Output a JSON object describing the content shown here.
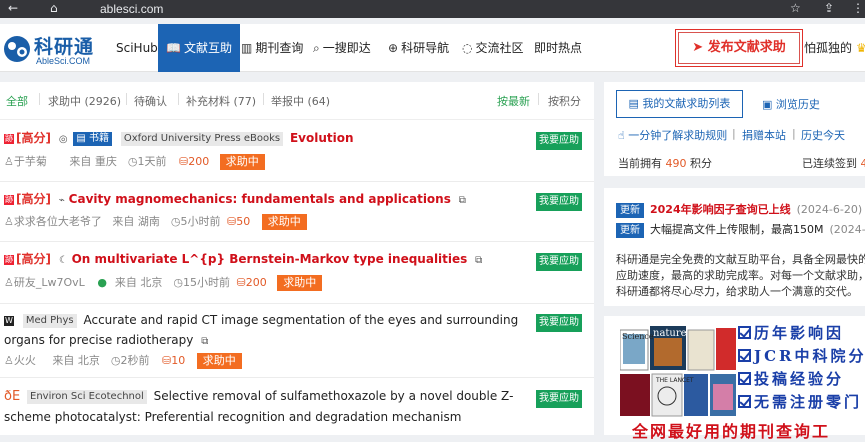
{
  "browser": {
    "url": "ablesci.com",
    "back_glyph": "←",
    "home_glyph": "⌂",
    "star_glyph": "☆",
    "ext_glyph": "⇪",
    "more_glyph": "⋮"
  },
  "header": {
    "logo_cn": "科研通",
    "logo_en": "AbleSci.COM",
    "nav": [
      {
        "label": "SciHub",
        "icon": ""
      },
      {
        "label": "文献互助",
        "icon": "open-book-icon"
      },
      {
        "label": "期刊查询",
        "icon": "journal-icon"
      },
      {
        "label": "一搜即达",
        "icon": "search-icon"
      },
      {
        "label": "科研导航",
        "icon": "globe-icon"
      },
      {
        "label": "交流社区",
        "icon": "chat-icon"
      },
      {
        "label": "即时热点",
        "icon": ""
      }
    ],
    "publish_label": "发布文献求助",
    "username": "怕孤独的"
  },
  "filters": {
    "all": "全部",
    "seeking": "求助中 (2926)",
    "pending": "待确认",
    "supplement": "补充材料 (77)",
    "reporting": "举报中 (64)",
    "sort_new": "按最新",
    "sort_points": "按积分"
  },
  "requests": [
    {
      "high_score": "[高分]",
      "journal": "Oxford University Press eBooks",
      "book_label": "书籍",
      "title": "Evolution",
      "user": "于芋菊",
      "origin": "来自 重庆",
      "time": "1天前",
      "points": "200",
      "status": "求助中",
      "action": "我要应助"
    },
    {
      "high_score": "[高分]",
      "journal": "",
      "title": "Cavity magnomechanics: fundamentals and applications",
      "user": "求求各位大老爷了",
      "origin": "来自 湖南",
      "time": "5小时前",
      "points": "50",
      "status": "求助中",
      "action": "我要应助"
    },
    {
      "high_score": "[高分]",
      "journal": "",
      "title": "On multivariate L^{p} Bernstein-Markov type inequalities",
      "user": "研友_Lw7OvL",
      "origin": "来自 北京",
      "time": "15小时前",
      "points": "200",
      "status": "求助中",
      "action": "我要应助"
    },
    {
      "high_score": "",
      "journal": "Med Phys",
      "title": "Accurate and rapid CT image segmentation of the eyes and surrounding organs for precise radiotherapy",
      "user": "火火",
      "origin": "来自 北京",
      "time": "2秒前",
      "points": "10",
      "status": "求助中",
      "action": "我要应助"
    },
    {
      "high_score": "",
      "journal": "Environ Sci Ecotechnol",
      "title": "Selective removal of sulfamethoxazole by a novel double Z-scheme photocatalyst: Preferential recognition and degradation mechanism",
      "user": "",
      "origin": "",
      "time": "",
      "points": "",
      "status": "",
      "action": "我要应助"
    }
  ],
  "sidebar": {
    "my_requests": "我的文献求助列表",
    "browse_history": "浏览历史",
    "learn_rules": "一分钟了解求助规则",
    "donate": "捐赠本站",
    "history_today": "历史今天",
    "points_prefix": "当前拥有",
    "points_value": "490",
    "points_suffix": "积分",
    "checkin_prefix": "已连续签到",
    "checkin_value": "4",
    "news": [
      {
        "badge": "更新",
        "text": "2024年影响因子查询已上线",
        "date": "(2024-6-20)"
      },
      {
        "badge": "更新",
        "text": "大幅提高文件上传限制，最高150M",
        "date": "(2024-4-"
      }
    ],
    "intro": "科研通是完全免费的文献互助平台，具备全网最快的应助速度，最高的求助完成率。对每一个文献求助，科研通都将尽心尽力，给求助人一个满意的交代。"
  },
  "promo": {
    "lines": [
      "历年影响因",
      "JCR中科院分",
      "投稿经验分",
      "无需注册零门"
    ],
    "bottom": "全网最好用的期刊查询工",
    "cover_labels": [
      "Science",
      "nature",
      "THE LANCET"
    ]
  }
}
